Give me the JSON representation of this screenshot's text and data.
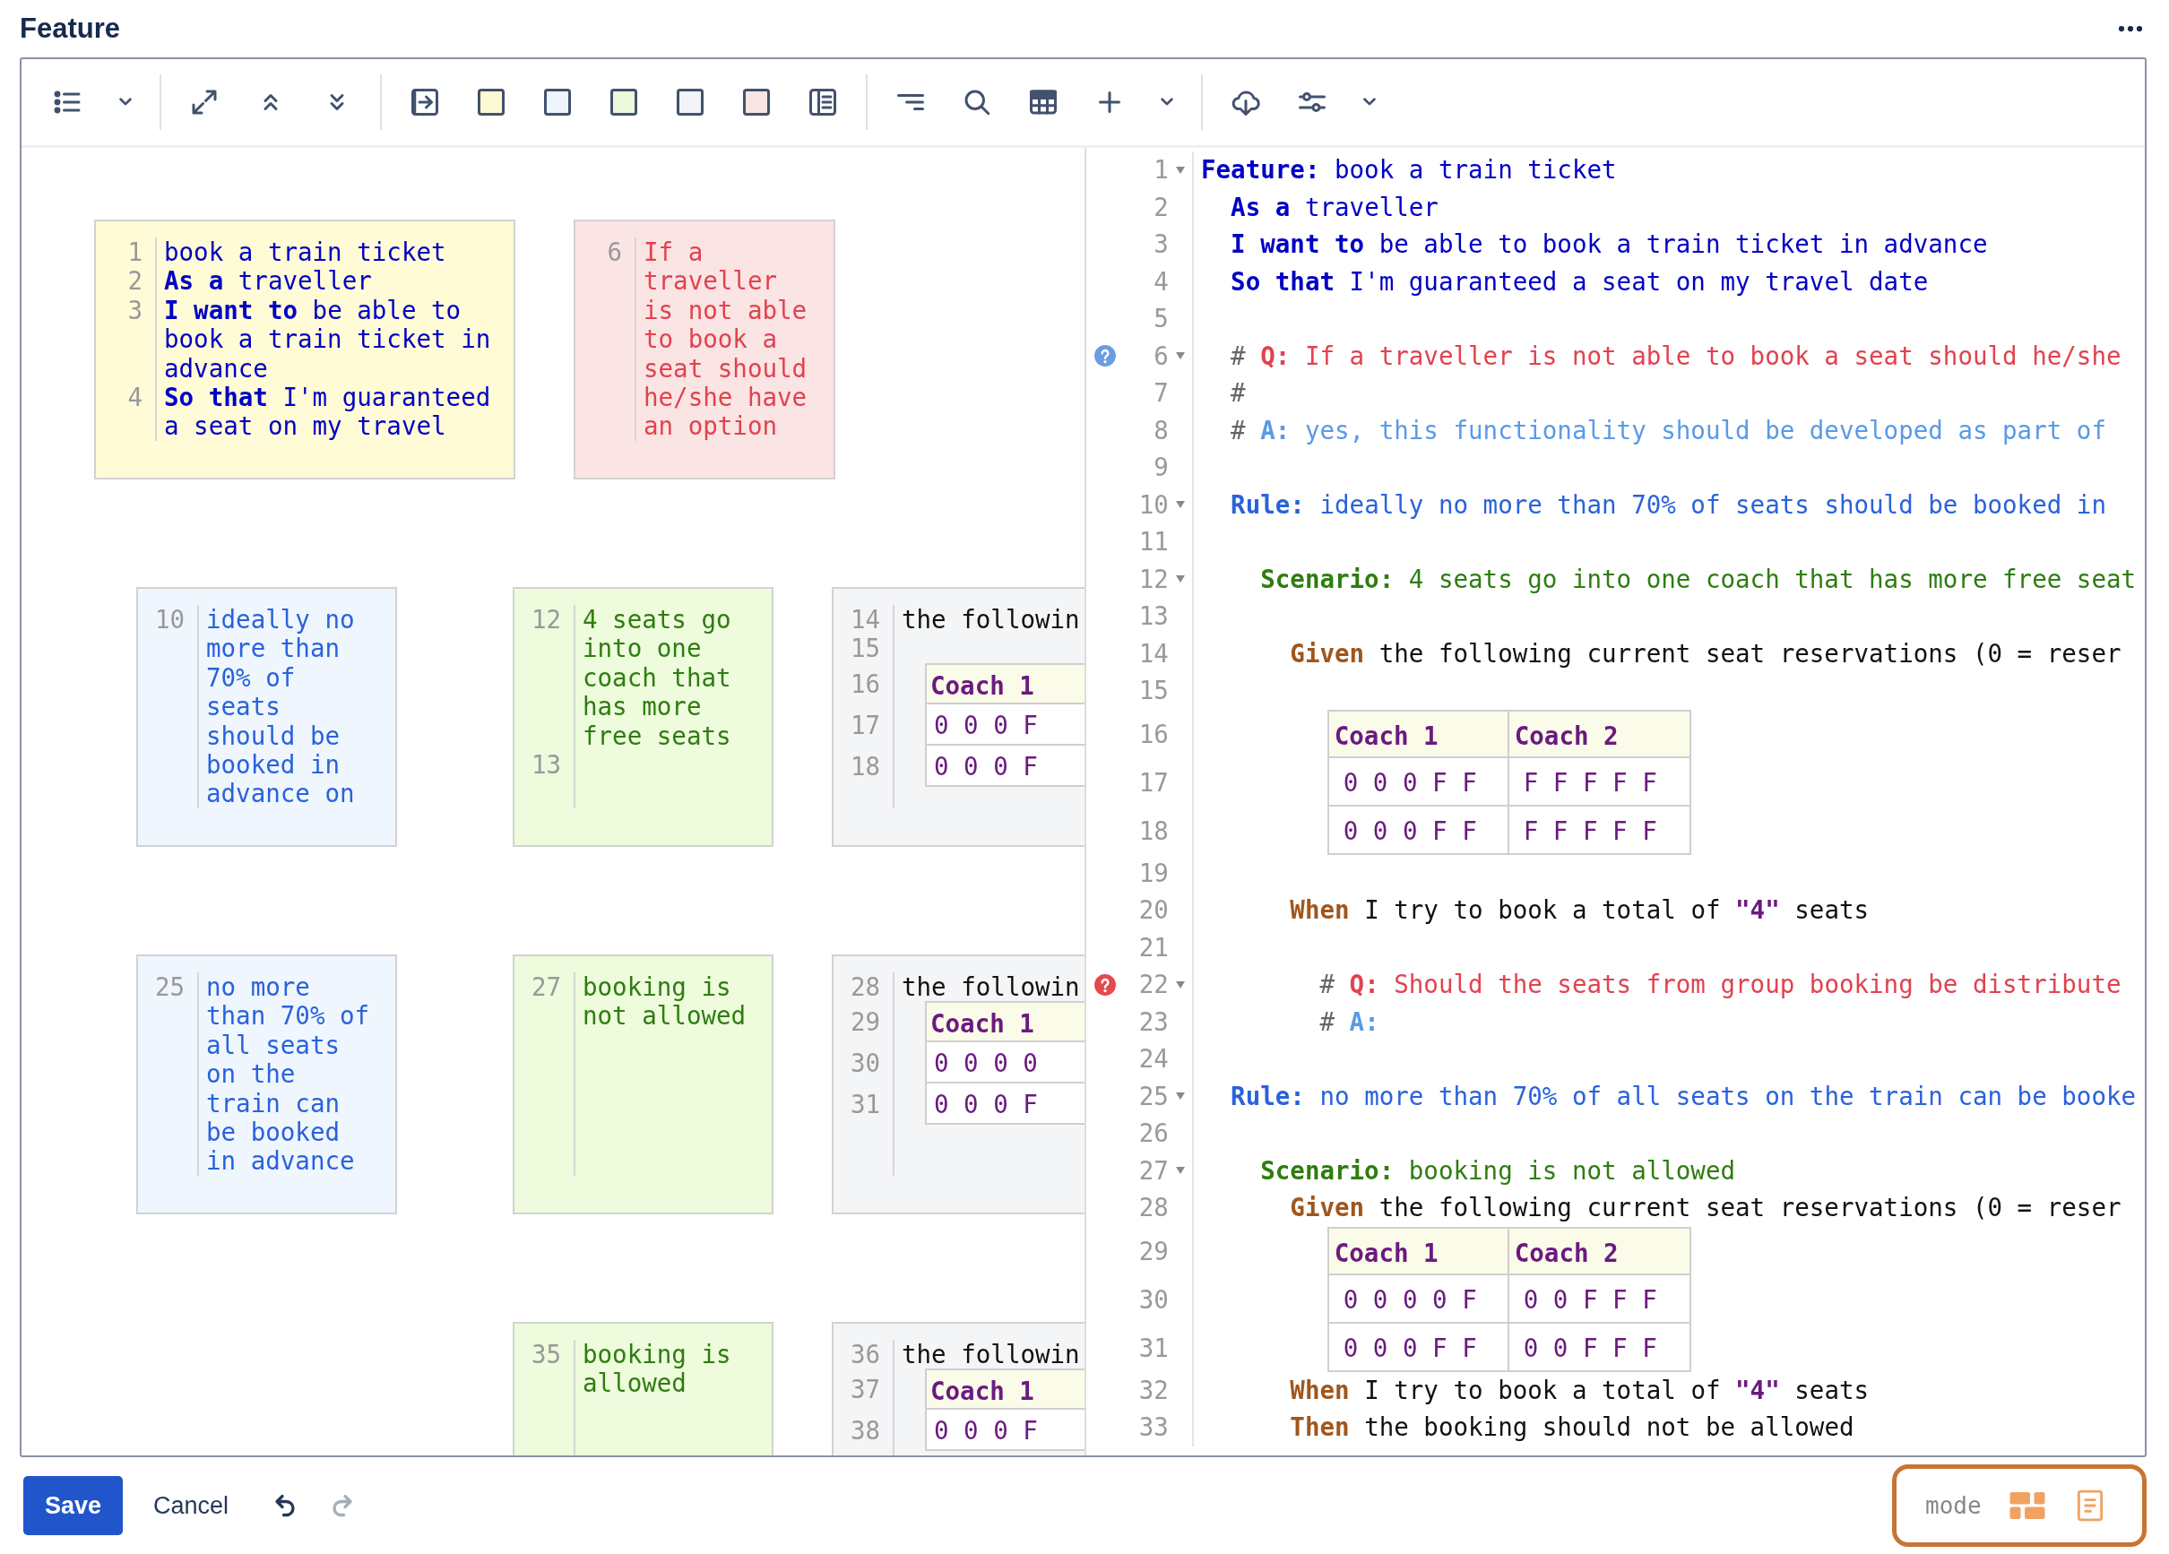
{
  "title": "Feature",
  "toolbar": {
    "swatches": [
      {
        "color": "#fdf9d3"
      },
      {
        "color": "#eef5fd"
      },
      {
        "color": "#ecf9dc"
      },
      {
        "color": "#f2f4f8"
      },
      {
        "color": "#fbe4e4"
      }
    ]
  },
  "board": {
    "rows": [
      {
        "kind": "feature-row",
        "cards": [
          {
            "kind": "feature",
            "lines": [
              {
                "number": "1",
                "kind": "text",
                "text": "book a train ticket"
              },
              {
                "number": "2",
                "kind": "text",
                "text": "**As a** traveller"
              },
              {
                "number": "3",
                "kind": "text",
                "text": "**I want to** be able to book a train ticket in advance"
              },
              {
                "number": "4",
                "kind": "text",
                "text": "**So that** I'm guaranteed a seat on my travel"
              }
            ]
          },
          {
            "kind": "question",
            "lines": [
              {
                "number": "6",
                "kind": "text",
                "text": "If a traveller is not able to book a seat should he/she have an option"
              }
            ]
          }
        ]
      },
      {
        "kind": "rule-row",
        "cards": [
          {
            "kind": "rule",
            "lines": [
              {
                "number": "10",
                "kind": "text",
                "text": "ideally no more than 70% of seats should be booked in advance on"
              }
            ]
          },
          {
            "kind": "scenario",
            "lines": [
              {
                "number": "12",
                "kind": "text",
                "text": "4 seats go into one coach that has more free seats"
              },
              {
                "number": "13",
                "kind": "blank"
              }
            ]
          },
          {
            "kind": "steps",
            "lines": [
              {
                "number": "14",
                "kind": "text",
                "text": "the followin"
              },
              {
                "number": "15",
                "kind": "blank"
              },
              {
                "number": "16",
                "kind": "header",
                "cells": [
                  "Coach 1"
                ]
              },
              {
                "number": "17",
                "kind": "row",
                "cells": [
                  "0 0 0 F"
                ]
              },
              {
                "number": "18",
                "kind": "row",
                "cells": [
                  "0 0 0 F"
                ]
              }
            ]
          }
        ]
      },
      {
        "kind": "rule-row",
        "cards": [
          {
            "kind": "rule",
            "lines": [
              {
                "number": "25",
                "kind": "text",
                "text": "no more than 70% of all seats on the train can be booked in advance"
              }
            ]
          },
          {
            "kind": "scenario",
            "lines": [
              {
                "number": "27",
                "kind": "text",
                "text": "booking is not allowed"
              }
            ]
          },
          {
            "kind": "steps",
            "lines": [
              {
                "number": "28",
                "kind": "text",
                "text": "the followin"
              },
              {
                "number": "29",
                "kind": "header",
                "cells": [
                  "Coach 1"
                ]
              },
              {
                "number": "30",
                "kind": "row",
                "cells": [
                  "0 0 0 0"
                ]
              },
              {
                "number": "31",
                "kind": "row",
                "cells": [
                  "0 0 0 F"
                ]
              }
            ]
          }
        ]
      },
      {
        "kind": "rule-row",
        "cards": [
          {
            "kind": "scenario",
            "lines": [
              {
                "number": "35",
                "kind": "text",
                "text": "booking is allowed"
              }
            ]
          },
          {
            "kind": "steps",
            "lines": [
              {
                "number": "36",
                "kind": "text",
                "text": "the followin"
              },
              {
                "number": "37",
                "kind": "header",
                "cells": [
                  "Coach 1"
                ]
              },
              {
                "number": "38",
                "kind": "row",
                "cells": [
                  "0 0 0 F"
                ]
              }
            ]
          }
        ]
      }
    ]
  },
  "editor": {
    "lines": [
      {
        "number": "1",
        "fold": true,
        "kind": "code",
        "parts": [
          {
            "kind": "feature-kw",
            "text": "Feature:"
          },
          {
            "kind": "feature",
            "text": " book a train ticket"
          }
        ]
      },
      {
        "number": "2",
        "fold": false,
        "kind": "code",
        "parts": [
          {
            "kind": "feature-kw",
            "text": "  As a"
          },
          {
            "kind": "feature",
            "text": " traveller"
          }
        ]
      },
      {
        "number": "3",
        "fold": false,
        "kind": "code",
        "parts": [
          {
            "kind": "feature-kw",
            "text": "  I want to"
          },
          {
            "kind": "feature",
            "text": " be able to book a train ticket in advance"
          }
        ]
      },
      {
        "number": "4",
        "fold": false,
        "kind": "code",
        "parts": [
          {
            "kind": "feature-kw",
            "text": "  So that"
          },
          {
            "kind": "feature",
            "text": " I'm guaranteed a seat on my travel date"
          }
        ]
      },
      {
        "number": "5",
        "fold": false,
        "kind": "blank"
      },
      {
        "number": "6",
        "fold": true,
        "marker": {
          "kind": "answered"
        },
        "kind": "code",
        "parts": [
          {
            "kind": "hash",
            "text": "  #"
          },
          {
            "kind": "q-kw",
            "text": " Q:"
          },
          {
            "kind": "q",
            "text": " If a traveller is not able to book a seat should he/she"
          }
        ]
      },
      {
        "number": "7",
        "fold": false,
        "kind": "code",
        "parts": [
          {
            "kind": "hash",
            "text": "  #"
          }
        ]
      },
      {
        "number": "8",
        "fold": false,
        "kind": "code",
        "parts": [
          {
            "kind": "hash",
            "text": "  #"
          },
          {
            "kind": "a-kw",
            "text": " A:"
          },
          {
            "kind": "a",
            "text": " yes, this functionality should be developed as part of"
          }
        ]
      },
      {
        "number": "9",
        "fold": false,
        "kind": "blank"
      },
      {
        "number": "10",
        "fold": true,
        "kind": "code",
        "parts": [
          {
            "kind": "rule-kw",
            "text": "  Rule:"
          },
          {
            "kind": "rule",
            "text": " ideally no more than 70% of seats should be booked in"
          }
        ]
      },
      {
        "number": "11",
        "fold": false,
        "kind": "blank"
      },
      {
        "number": "12",
        "fold": true,
        "kind": "code",
        "parts": [
          {
            "kind": "scenario-kw",
            "text": "    Scenario:"
          },
          {
            "kind": "scenario",
            "text": " 4 seats go into one coach that has more free seat"
          }
        ]
      },
      {
        "number": "13",
        "fold": false,
        "kind": "blank"
      },
      {
        "number": "14",
        "fold": false,
        "kind": "code",
        "parts": [
          {
            "kind": "step-kw",
            "text": "      Given"
          },
          {
            "kind": "plain",
            "text": " the following current seat reservations (0 = reser"
          }
        ]
      },
      {
        "number": "15",
        "fold": false,
        "kind": "blank"
      },
      {
        "number": "16",
        "fold": false,
        "kind": "header",
        "cells": [
          "Coach 1",
          "Coach 2"
        ]
      },
      {
        "number": "17",
        "fold": false,
        "kind": "row",
        "cells": [
          "0 0 0 F F",
          "F F F F F"
        ]
      },
      {
        "number": "18",
        "fold": false,
        "kind": "row",
        "cells": [
          "0 0 0 F F",
          "F F F F F"
        ]
      },
      {
        "number": "19",
        "fold": false,
        "kind": "blank"
      },
      {
        "number": "20",
        "fold": false,
        "kind": "code",
        "parts": [
          {
            "kind": "step-kw",
            "text": "      When"
          },
          {
            "kind": "plain",
            "text": " I try to book a total of "
          },
          {
            "kind": "string",
            "text": "\"4\""
          },
          {
            "kind": "plain",
            "text": " seats"
          }
        ]
      },
      {
        "number": "21",
        "fold": false,
        "kind": "blank"
      },
      {
        "number": "22",
        "fold": true,
        "marker": {
          "kind": "open"
        },
        "kind": "code",
        "parts": [
          {
            "kind": "hash",
            "text": "        #"
          },
          {
            "kind": "q-kw",
            "text": " Q:"
          },
          {
            "kind": "q",
            "text": " Should the seats from group booking be distribute"
          }
        ]
      },
      {
        "number": "23",
        "fold": false,
        "kind": "code",
        "parts": [
          {
            "kind": "hash",
            "text": "        #"
          },
          {
            "kind": "a-kw",
            "text": " A:"
          }
        ]
      },
      {
        "number": "24",
        "fold": false,
        "kind": "blank"
      },
      {
        "number": "25",
        "fold": true,
        "kind": "code",
        "parts": [
          {
            "kind": "rule-kw",
            "text": "  Rule:"
          },
          {
            "kind": "rule",
            "text": " no more than 70% of all seats on the train can be booke"
          }
        ]
      },
      {
        "number": "26",
        "fold": false,
        "kind": "blank"
      },
      {
        "number": "27",
        "fold": true,
        "kind": "code",
        "parts": [
          {
            "kind": "scenario-kw",
            "text": "    Scenario:"
          },
          {
            "kind": "scenario",
            "text": " booking is not allowed"
          }
        ]
      },
      {
        "number": "28",
        "fold": false,
        "kind": "code",
        "parts": [
          {
            "kind": "step-kw",
            "text": "      Given"
          },
          {
            "kind": "plain",
            "text": " the following current seat reservations (0 = reser"
          }
        ]
      },
      {
        "number": "29",
        "fold": false,
        "kind": "header",
        "cells": [
          "Coach 1",
          "Coach 2"
        ]
      },
      {
        "number": "30",
        "fold": false,
        "kind": "row",
        "cells": [
          "0 0 0 0 F",
          "0 0 F F F"
        ]
      },
      {
        "number": "31",
        "fold": false,
        "kind": "row",
        "cells": [
          "0 0 0 F F",
          "0 0 F F F"
        ]
      },
      {
        "number": "32",
        "fold": false,
        "kind": "code",
        "parts": [
          {
            "kind": "step-kw",
            "text": "      When"
          },
          {
            "kind": "plain",
            "text": " I try to book a total of "
          },
          {
            "kind": "string",
            "text": "\"4\""
          },
          {
            "kind": "plain",
            "text": " seats"
          }
        ]
      },
      {
        "number": "33",
        "fold": false,
        "kind": "code",
        "parts": [
          {
            "kind": "step-kw",
            "text": "      Then"
          },
          {
            "kind": "plain",
            "text": " the booking should not be allowed"
          }
        ]
      }
    ]
  },
  "footer": {
    "save": "Save",
    "cancel": "Cancel",
    "undo": {
      "disabled": false
    },
    "redo": {
      "disabled": true
    },
    "mode_label": "mode"
  }
}
